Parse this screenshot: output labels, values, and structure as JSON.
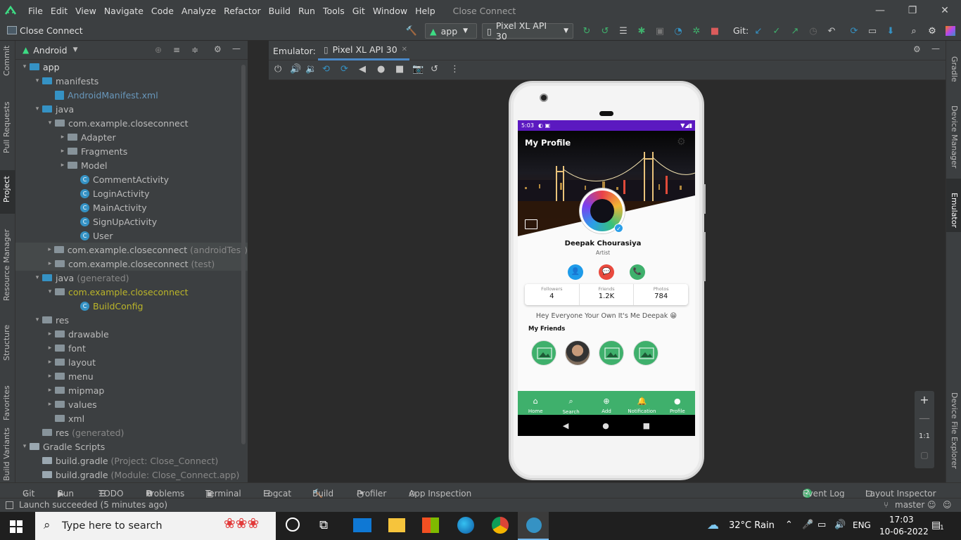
{
  "menu": [
    "File",
    "Edit",
    "View",
    "Navigate",
    "Code",
    "Analyze",
    "Refactor",
    "Build",
    "Run",
    "Tools",
    "Git",
    "Window",
    "Help"
  ],
  "window_title": "Close Connect",
  "breadcrumb": "Close Connect",
  "run_config": "app",
  "device_combo": "Pixel XL API 30",
  "git_label": "Git:",
  "project_view": "Android",
  "left_tools": [
    "Commit",
    "Pull Requests",
    "Project",
    "Resource Manager",
    "Structure",
    "Favorites",
    "Build Variants"
  ],
  "right_tools": [
    "Gradle",
    "Device Manager",
    "Emulator",
    "Device File Explorer"
  ],
  "tree": [
    {
      "label": "app",
      "indent": 0,
      "arrow": "▾",
      "icon": "folder",
      "bold": true
    },
    {
      "label": "manifests",
      "indent": 1,
      "arrow": "▾",
      "icon": "folder"
    },
    {
      "label": "AndroidManifest.xml",
      "indent": 2,
      "arrow": "",
      "icon": "xml",
      "color": "#6897bb"
    },
    {
      "label": "java",
      "indent": 1,
      "arrow": "▾",
      "icon": "folder"
    },
    {
      "label": "com.example.closeconnect",
      "indent": 2,
      "arrow": "▾",
      "icon": "package"
    },
    {
      "label": "Adapter",
      "indent": 3,
      "arrow": "▸",
      "icon": "package"
    },
    {
      "label": "Fragments",
      "indent": 3,
      "arrow": "▸",
      "icon": "package"
    },
    {
      "label": "Model",
      "indent": 3,
      "arrow": "▸",
      "icon": "package"
    },
    {
      "label": "CommentActivity",
      "indent": 4,
      "arrow": "",
      "icon": "class"
    },
    {
      "label": "LoginActivity",
      "indent": 4,
      "arrow": "",
      "icon": "class"
    },
    {
      "label": "MainActivity",
      "indent": 4,
      "arrow": "",
      "icon": "class"
    },
    {
      "label": "SignUpActivity",
      "indent": 4,
      "arrow": "",
      "icon": "class"
    },
    {
      "label": "User",
      "indent": 4,
      "arrow": "",
      "icon": "class"
    },
    {
      "label": "com.example.closeconnect",
      "suffix": "(androidTest)",
      "indent": 2,
      "arrow": "▸",
      "icon": "package",
      "hl": true
    },
    {
      "label": "com.example.closeconnect",
      "suffix": "(test)",
      "indent": 2,
      "arrow": "▸",
      "icon": "package",
      "hl": true
    },
    {
      "label": "java",
      "suffix": "(generated)",
      "indent": 1,
      "arrow": "▾",
      "icon": "folder"
    },
    {
      "label": "com.example.closeconnect",
      "indent": 2,
      "arrow": "▾",
      "icon": "package",
      "color": "#bbb529"
    },
    {
      "label": "BuildConfig",
      "indent": 4,
      "arrow": "",
      "icon": "class",
      "color": "#bbb529"
    },
    {
      "label": "res",
      "indent": 1,
      "arrow": "▾",
      "icon": "folder"
    },
    {
      "label": "drawable",
      "indent": 2,
      "arrow": "▸",
      "icon": "folder"
    },
    {
      "label": "font",
      "indent": 2,
      "arrow": "▸",
      "icon": "folder"
    },
    {
      "label": "layout",
      "indent": 2,
      "arrow": "▸",
      "icon": "folder"
    },
    {
      "label": "menu",
      "indent": 2,
      "arrow": "▸",
      "icon": "folder"
    },
    {
      "label": "mipmap",
      "indent": 2,
      "arrow": "▸",
      "icon": "folder"
    },
    {
      "label": "values",
      "indent": 2,
      "arrow": "▸",
      "icon": "folder"
    },
    {
      "label": "xml",
      "indent": 2,
      "arrow": "",
      "icon": "folder"
    },
    {
      "label": "res",
      "suffix": "(generated)",
      "indent": 1,
      "arrow": "",
      "icon": "folder"
    },
    {
      "label": "Gradle Scripts",
      "indent": 0,
      "arrow": "▾",
      "icon": "gradle"
    },
    {
      "label": "build.gradle",
      "suffix": "(Project: Close_Connect)",
      "indent": 1,
      "arrow": "",
      "icon": "gradle"
    },
    {
      "label": "build.gradle",
      "suffix": "(Module: Close_Connect.app)",
      "indent": 1,
      "arrow": "",
      "icon": "gradle"
    }
  ],
  "emulator": {
    "label": "Emulator:",
    "tab": "Pixel XL API 30"
  },
  "phone": {
    "time": "5:03",
    "title": "My Profile",
    "name": "Deepak Chourasiya",
    "role": "Artist",
    "stats": [
      {
        "label": "Followers",
        "value": "4"
      },
      {
        "label": "Friends",
        "value": "1.2K"
      },
      {
        "label": "Photos",
        "value": "784"
      }
    ],
    "bio": "Hey Everyone Your Own It's Me Deepak 😁",
    "friends_title": "My Friends",
    "nav": [
      "Home",
      "Search",
      "Add",
      "Notification",
      "Profile"
    ]
  },
  "bottom_tabs": [
    "Git",
    "Run",
    "TODO",
    "Problems",
    "Terminal",
    "Logcat",
    "Build",
    "Profiler",
    "App Inspection"
  ],
  "event_log": {
    "count": "2",
    "label": "Event Log"
  },
  "layout_inspector": "Layout Inspector",
  "status": "Launch succeeded (5 minutes ago)",
  "branch": "master",
  "taskbar": {
    "search": "Type here to search",
    "weather": "32°C  Rain",
    "lang": "ENG",
    "time": "17:03",
    "date": "10-06-2022",
    "notif": "1"
  },
  "zoom": {
    "ratio": "1:1"
  }
}
